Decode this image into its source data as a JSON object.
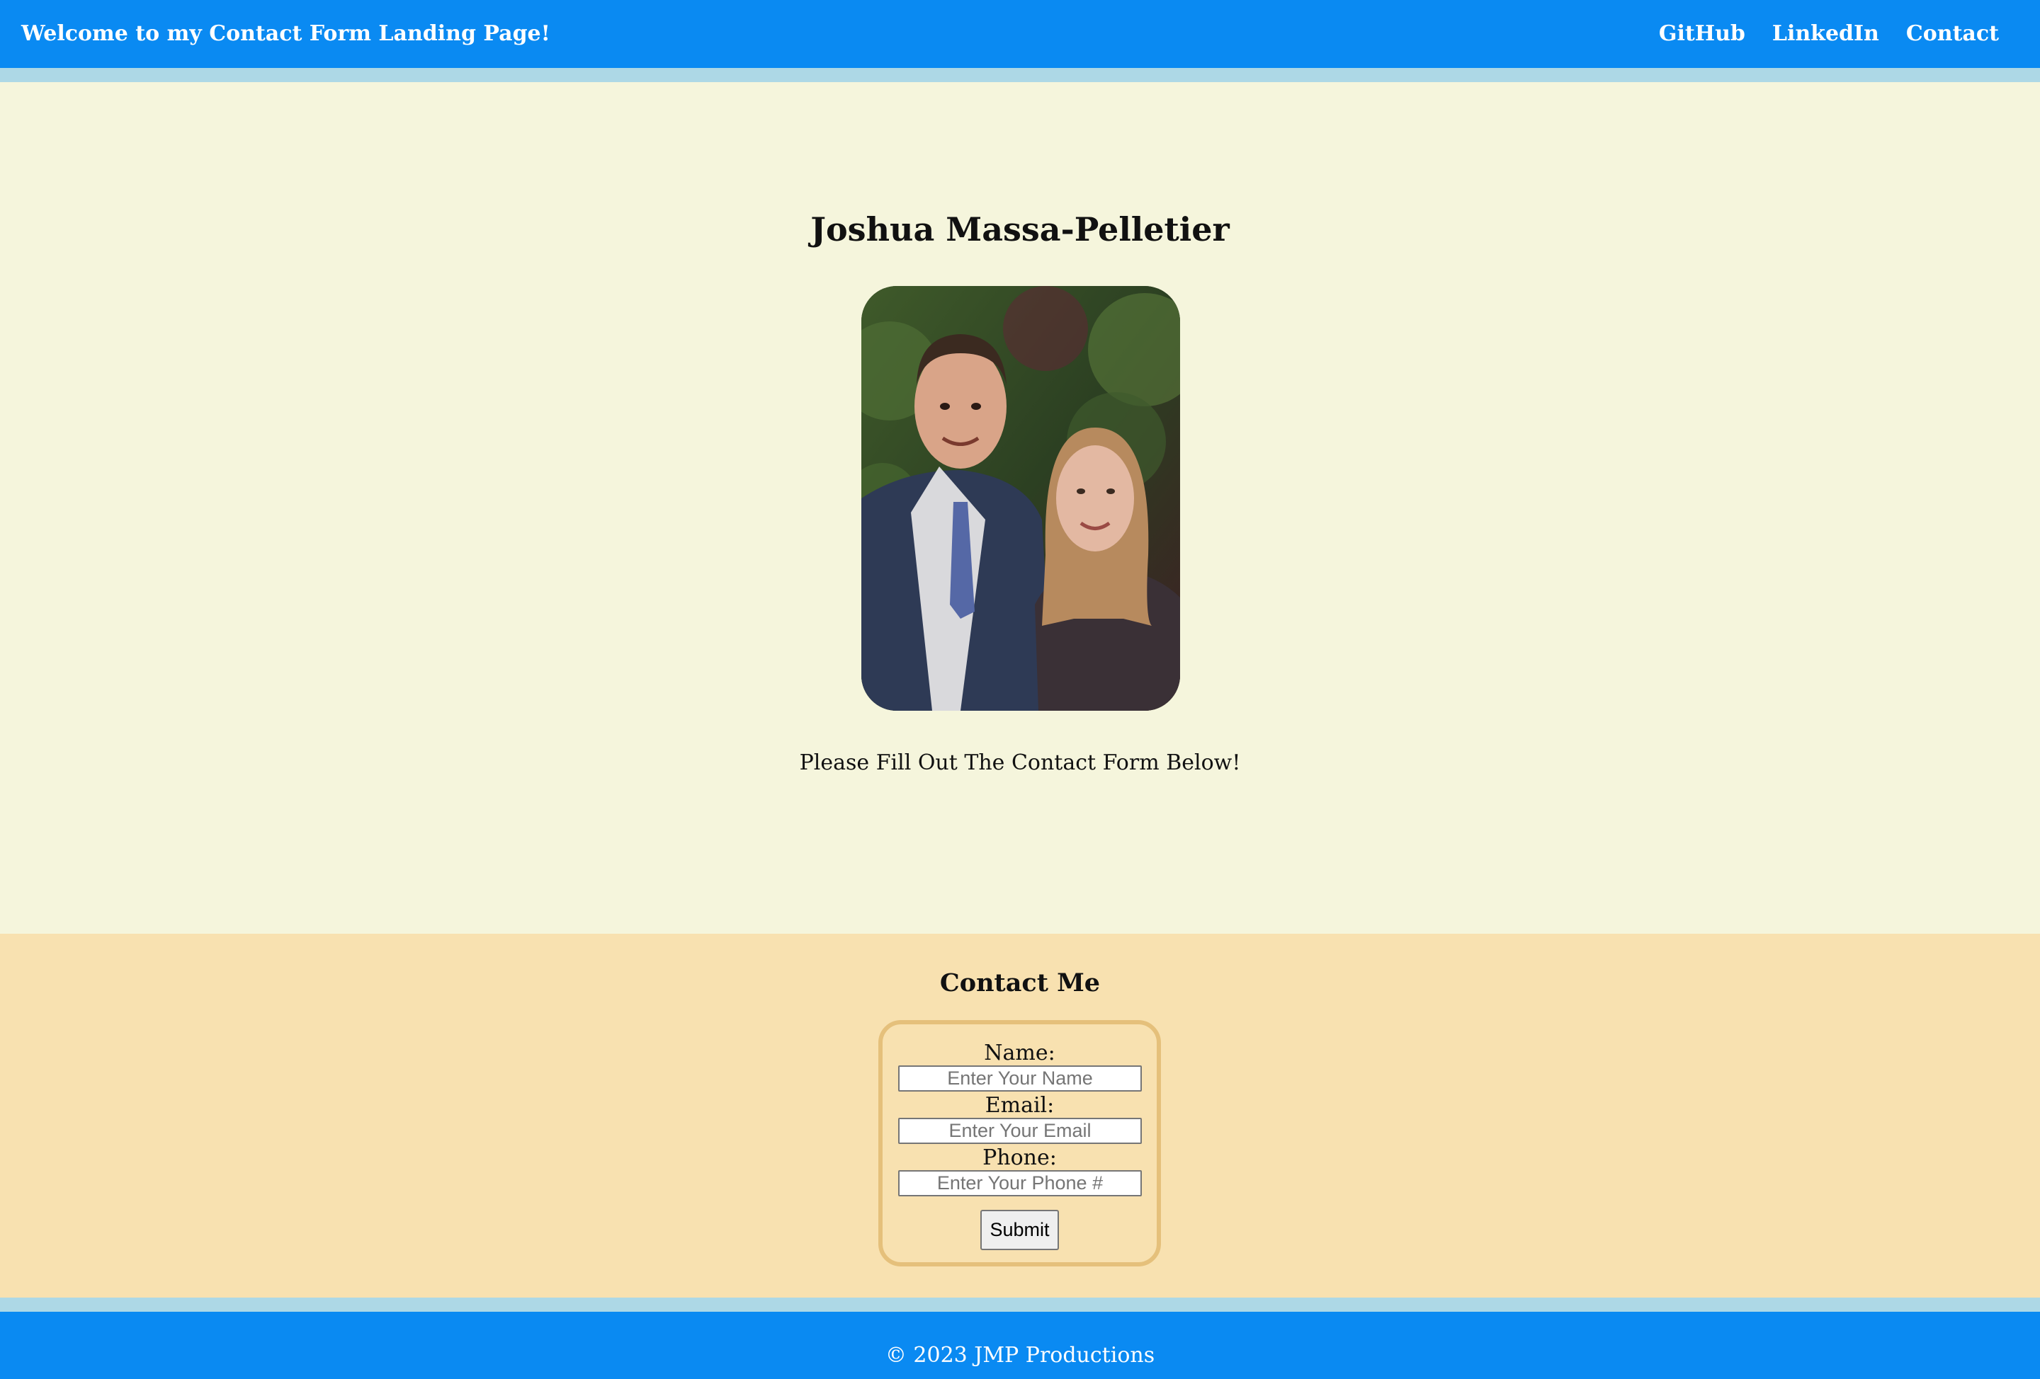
{
  "header": {
    "title": "Welcome to my Contact Form Landing Page!",
    "nav": [
      {
        "label": "GitHub"
      },
      {
        "label": "LinkedIn"
      },
      {
        "label": "Contact"
      }
    ]
  },
  "hero": {
    "name": "Joshua Massa-Pelletier",
    "tagline": "Please Fill Out The Contact Form Below!"
  },
  "contact": {
    "title": "Contact Me",
    "fields": [
      {
        "label": "Name:",
        "placeholder": "Enter Your Name",
        "value": ""
      },
      {
        "label": "Email:",
        "placeholder": "Enter Your Email",
        "value": ""
      },
      {
        "label": "Phone:",
        "placeholder": "Enter Your Phone #",
        "value": ""
      }
    ],
    "submit_label": "Submit"
  },
  "footer": {
    "text": "© 2023 JMP Productions"
  },
  "colors": {
    "header_bg": "#0a8af2",
    "accent_border": "#add8e6",
    "hero_bg": "#f5f5dc",
    "contact_bg": "#f8e1b0",
    "form_border": "#e5c07b"
  }
}
